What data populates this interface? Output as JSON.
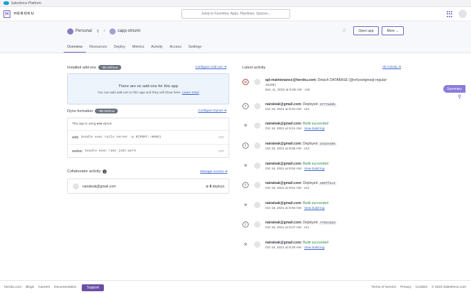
{
  "sf": {
    "title": "Salesforce Platform"
  },
  "nav": {
    "brand": "HEROKU",
    "search_placeholder": "Jump to Favorites, Apps, Pipelines, Spaces..."
  },
  "app": {
    "team": "Personal",
    "name": "capp-otnumi",
    "open_label": "Open app",
    "more_label": "More"
  },
  "tabs": [
    "Overview",
    "Resources",
    "Deploy",
    "Metrics",
    "Activity",
    "Access",
    "Settings"
  ],
  "addons": {
    "title": "Installed add-ons",
    "price": "~$0.00/hour",
    "configure": "Configure Add-ons",
    "empty_title": "There are no add-ons for this app",
    "empty_text": "You can add add-ons to this app and they will show here.",
    "learn": "Learn more"
  },
  "dyno": {
    "title": "Dyno formation",
    "price": "~$0.00/hour",
    "configure": "Configure Dynos",
    "eco_prefix": "This app is using",
    "eco_word": "eco",
    "eco_suffix": "dynos",
    "rows": [
      {
        "name": "web",
        "cmd": "bundle exec rails server -p ${PORT:-5000}",
        "state": "OFF"
      },
      {
        "name": "worker",
        "cmd": "bundle exec rake jobs:work",
        "state": "OFF"
      }
    ]
  },
  "collab": {
    "title": "Collaborator activity",
    "manage": "Manage Access",
    "email": "nairaleak@gmail.com",
    "deploys": "8",
    "deploys_label": "deploys"
  },
  "activity": {
    "title": "Latest activity",
    "all": "All Activity",
    "items": [
      {
        "user": "api-maintenance@heroku.com:",
        "text": "Detach DATABASE (@ref:postgresql-regular-",
        "text2": "15335)",
        "time": "Dec 11, 2022 at 8:06 AM · v15",
        "kind": "detach"
      },
      {
        "user": "nairaleak@gmail.com:",
        "text": "Deployed",
        "sha": "d777ad6b",
        "time": "Oct 16, 2021 at 9:22 AM · v14",
        "kind": "deploy"
      },
      {
        "user": "nairaleak@gmail.com:",
        "text": "Build succeeded",
        "time": "Oct 16, 2021 at 9:21 AM ·",
        "link": "View build log",
        "kind": "build"
      },
      {
        "user": "nairaleak@gmail.com:",
        "text": "Deployed",
        "sha": "2432e366",
        "time": "Oct 16, 2021 at 8:55 AM · v13",
        "kind": "deploy"
      },
      {
        "user": "nairaleak@gmail.com:",
        "text": "Build succeeded",
        "time": "Oct 16, 2021 at 8:54 AM ·",
        "link": "View build log",
        "kind": "build"
      },
      {
        "user": "nairaleak@gmail.com:",
        "text": "Deployed",
        "sha": "405ffec3",
        "time": "Oct 16, 2021 at 8:51 AM · v12",
        "kind": "deploy"
      },
      {
        "user": "nairaleak@gmail.com:",
        "text": "Build succeeded",
        "time": "Oct 16, 2021 at 8:50 AM ·",
        "link": "View build log",
        "kind": "build"
      },
      {
        "user": "nairaleak@gmail.com:",
        "text": "Deployed",
        "sha": "7792c82d",
        "time": "Oct 16, 2021 at 8:27 AM · v11",
        "kind": "deploy"
      },
      {
        "user": "nairaleak@gmail.com:",
        "text": "Build succeeded",
        "time": "Oct 16, 2021 at 8:25 AM ·",
        "link": "View build log",
        "kind": "build"
      }
    ]
  },
  "side": {
    "summary": "Summary"
  },
  "footer": {
    "left": [
      "heroku.com",
      "Blogs",
      "Careers",
      "Documentation"
    ],
    "support": "Support",
    "right": [
      "Terms of Service",
      "Privacy",
      "Cookies",
      "© 2023 Salesforce.com"
    ]
  }
}
